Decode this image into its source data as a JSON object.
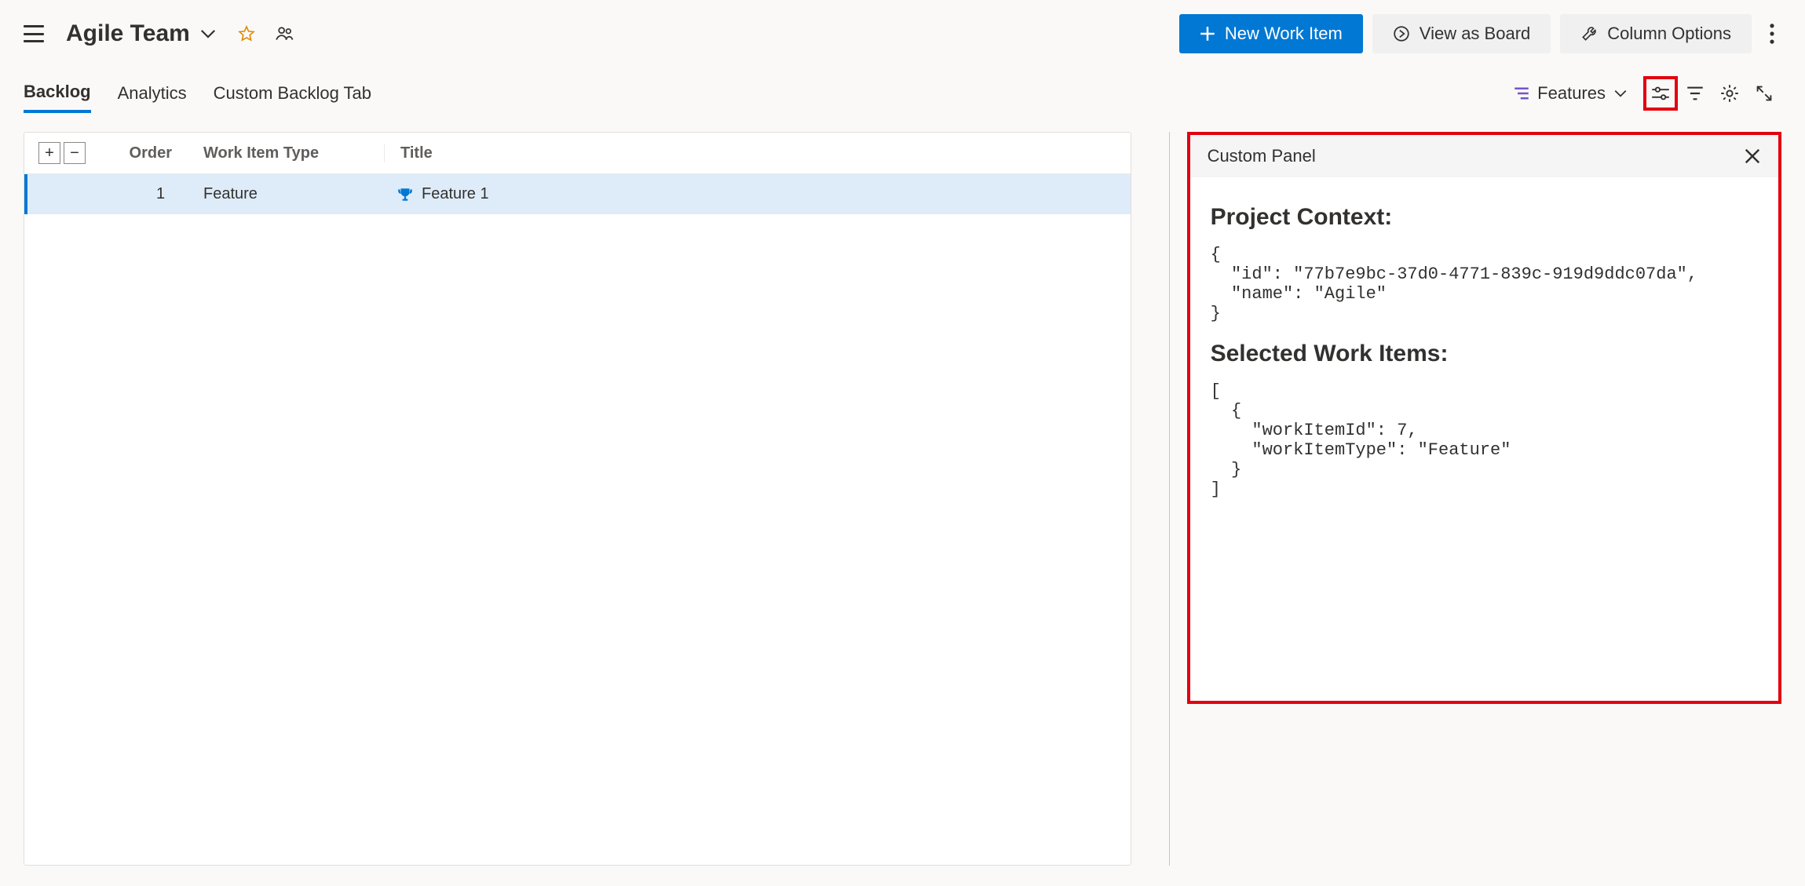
{
  "header": {
    "team_name": "Agile Team",
    "new_work_item": "New Work Item",
    "view_as_board": "View as Board",
    "column_options": "Column Options"
  },
  "tabs": {
    "backlog": "Backlog",
    "analytics": "Analytics",
    "custom": "Custom Backlog Tab",
    "level_label": "Features"
  },
  "grid": {
    "col_order": "Order",
    "col_type": "Work Item Type",
    "col_title": "Title",
    "rows": [
      {
        "order": "1",
        "type": "Feature",
        "title": "Feature 1"
      }
    ]
  },
  "panel": {
    "title": "Custom Panel",
    "h1": "Project Context:",
    "ctx": "{\n  \"id\": \"77b7e9bc-37d0-4771-839c-919d9ddc07da\",\n  \"name\": \"Agile\"\n}",
    "h2": "Selected Work Items:",
    "sel": "[\n  {\n    \"workItemId\": 7,\n    \"workItemType\": \"Feature\"\n  }\n]"
  }
}
